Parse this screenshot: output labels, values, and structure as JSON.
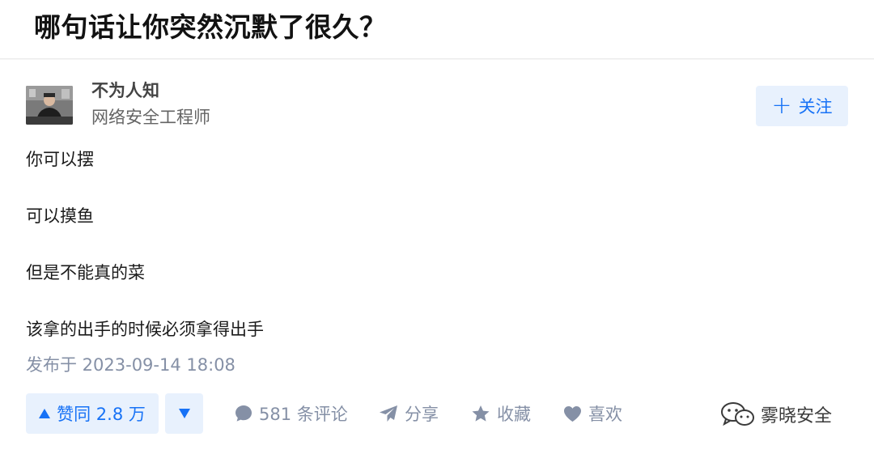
{
  "question": {
    "title": "哪句话让你突然沉默了很久？"
  },
  "author": {
    "name": "不为人知",
    "headline": "网络安全工程师",
    "follow_label": "关注",
    "follow_icon": "plus-icon"
  },
  "answer": {
    "lines": [
      "你可以摆",
      "可以摸鱼",
      "但是不能真的菜",
      "该拿的出手的时候必须拿得出手"
    ],
    "published": "发布于 2023-09-14 18:08"
  },
  "actions": {
    "upvote_label": "赞同 2.8 万",
    "upvote_icon": "triangle-up-icon",
    "downvote_icon": "triangle-down-icon",
    "comments_label": "581 条评论",
    "share_label": "分享",
    "favorite_label": "收藏",
    "like_label": "喜欢"
  },
  "watermark": {
    "text": "雾晓安全"
  },
  "colors": {
    "accent": "#1772f6",
    "accent_bg": "#e8f1fd",
    "muted": "#8590a6"
  }
}
